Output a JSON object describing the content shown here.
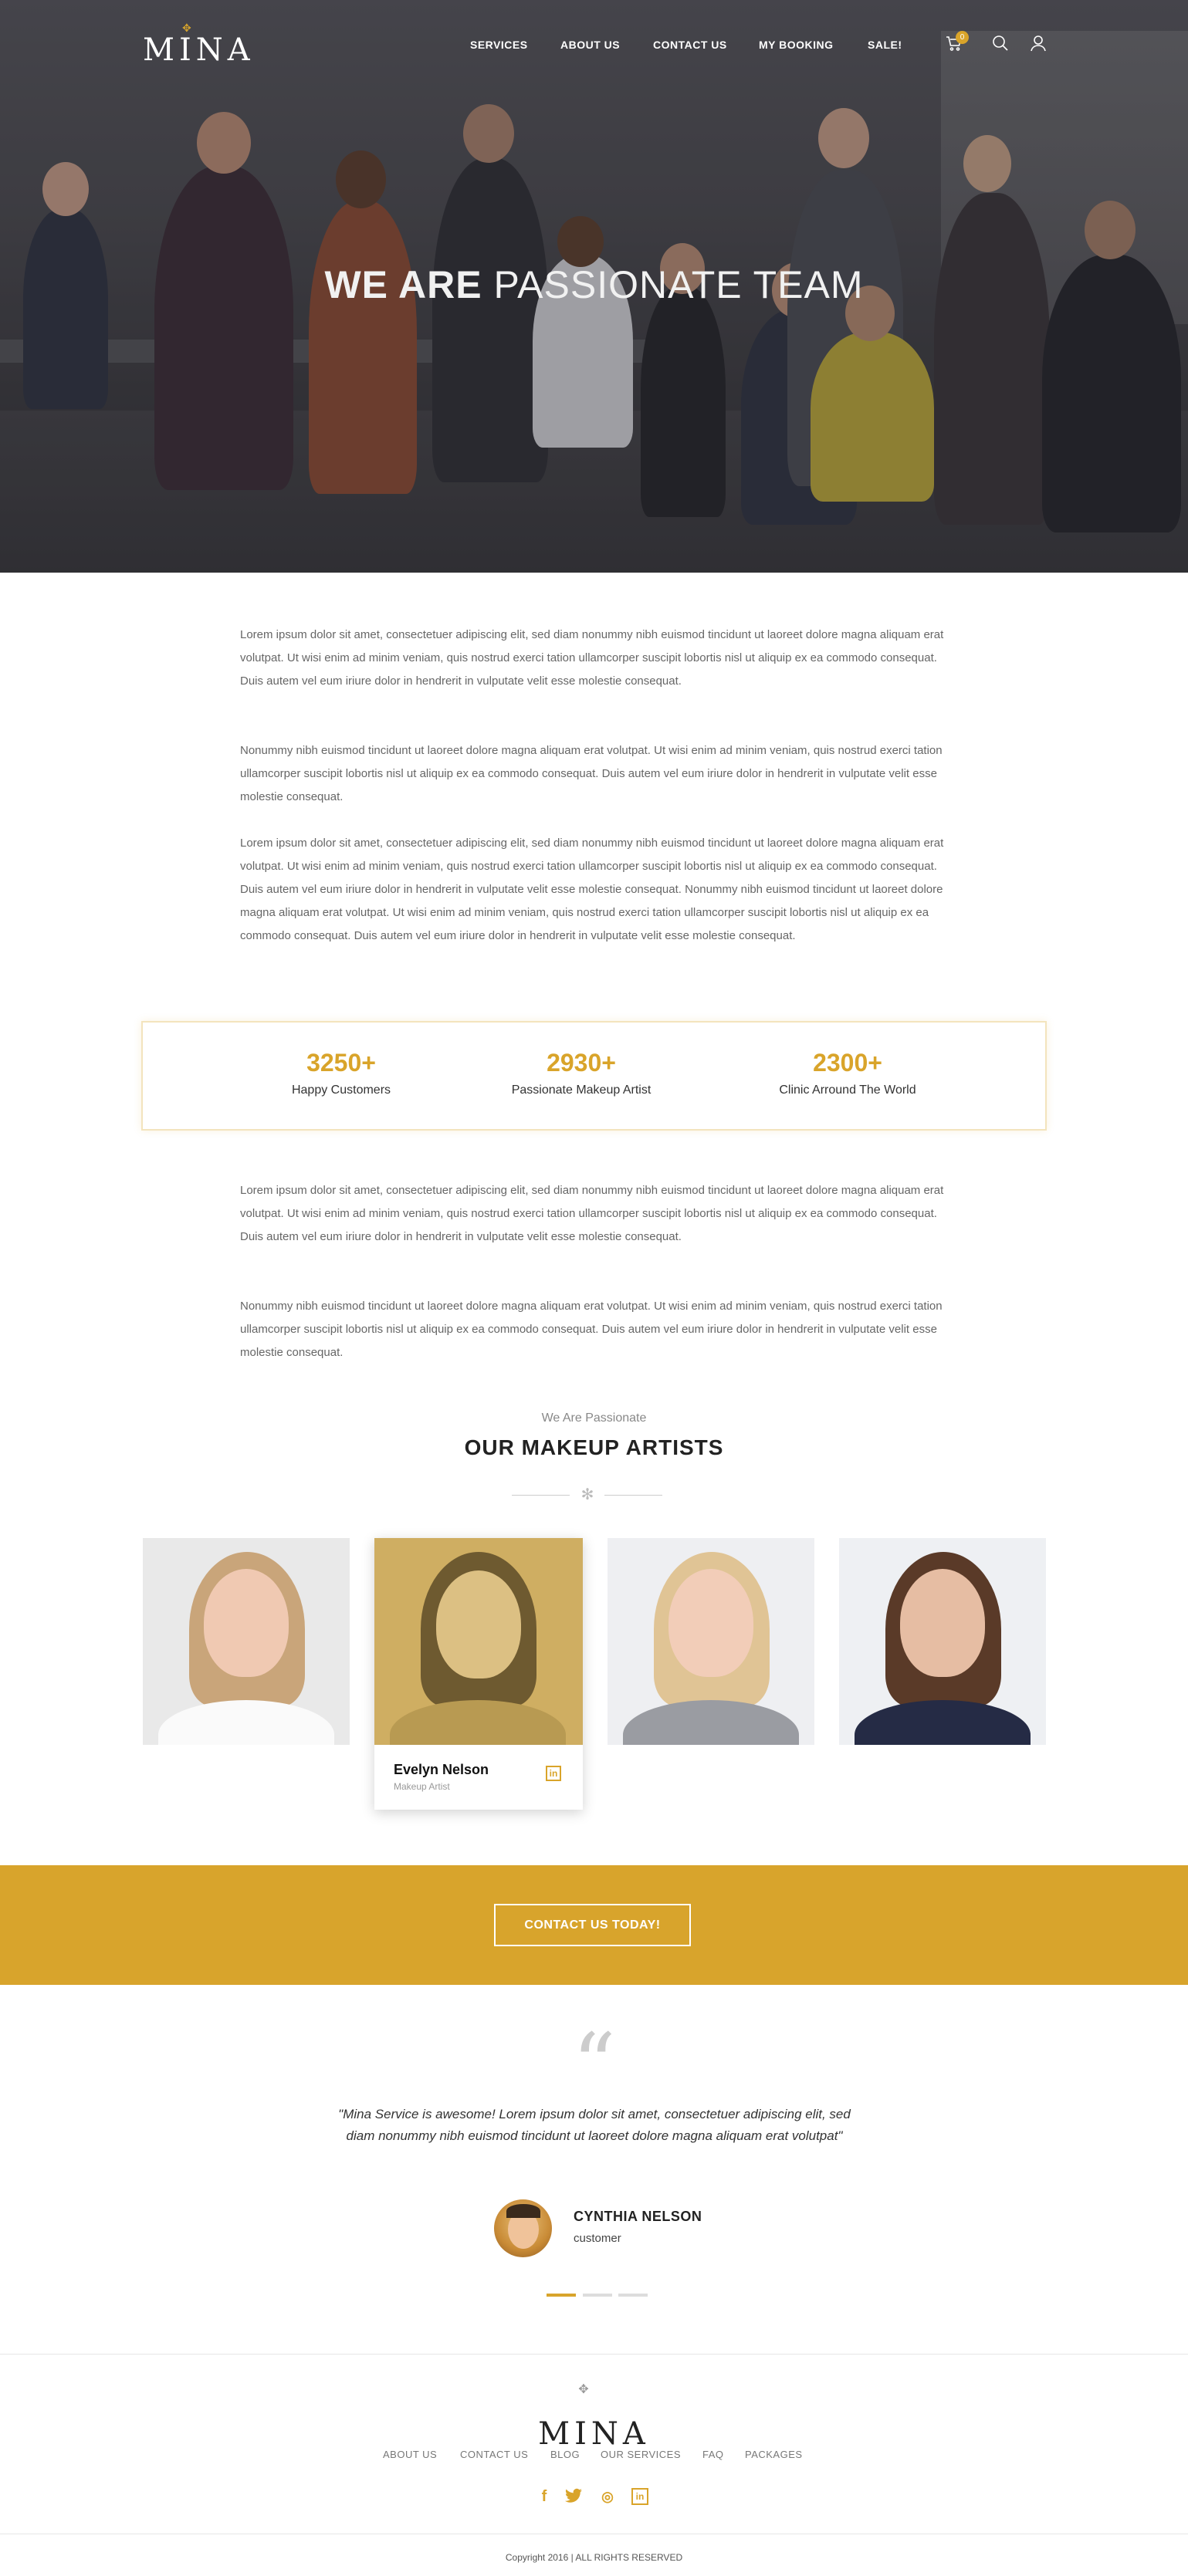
{
  "header": {
    "logo": "MINA",
    "nav": [
      "SERVICES",
      "ABOUT US",
      "CONTACT US",
      "MY BOOKING",
      "SALE!"
    ],
    "cart_count": "0",
    "icons": [
      "cart-icon",
      "search-icon",
      "user-icon"
    ]
  },
  "hero": {
    "title_bold": "WE ARE",
    "title_light": "PASSIONATE TEAM"
  },
  "intro_paragraphs": [
    "Lorem ipsum dolor sit amet, consectetuer adipiscing elit, sed diam nonummy nibh euismod tincidunt ut laoreet dolore magna aliquam erat volutpat. Ut wisi enim ad minim veniam, quis nostrud exerci tation ullamcorper suscipit lobortis nisl ut aliquip ex ea commodo consequat. Duis autem vel eum iriure dolor in hendrerit in vulputate velit esse molestie consequat.",
    "Nonummy nibh euismod tincidunt ut laoreet dolore magna aliquam erat volutpat. Ut wisi enim ad minim veniam, quis nostrud exerci tation ullamcorper suscipit lobortis nisl ut aliquip ex ea commodo consequat. Duis autem vel eum iriure dolor in hendrerit in vulputate velit esse molestie consequat.",
    "Lorem ipsum dolor sit amet, consectetuer adipiscing elit, sed diam nonummy nibh euismod tincidunt ut laoreet dolore magna aliquam erat volutpat. Ut wisi enim ad minim veniam, quis nostrud exerci tation ullamcorper suscipit lobortis nisl ut aliquip ex ea commodo consequat. Duis autem vel eum iriure dolor in hendrerit in vulputate velit esse molestie consequat. Nonummy nibh euismod tincidunt ut laoreet dolore magna aliquam erat volutpat. Ut wisi enim ad minim veniam, quis nostrud exerci tation ullamcorper suscipit lobortis nisl ut aliquip ex ea commodo consequat. Duis autem vel eum iriure dolor in hendrerit in vulputate velit esse molestie consequat."
  ],
  "stats": [
    {
      "value": "3250+",
      "label": "Happy Customers"
    },
    {
      "value": "2930+",
      "label": "Passionate Makeup Artist"
    },
    {
      "value": "2300+",
      "label": "Clinic Arround The World"
    }
  ],
  "more_paragraphs": [
    "Lorem ipsum dolor sit amet, consectetuer adipiscing elit, sed diam nonummy nibh euismod tincidunt ut laoreet dolore magna aliquam erat volutpat. Ut wisi enim ad minim veniam, quis nostrud exerci tation ullamcorper suscipit lobortis nisl ut aliquip ex ea commodo consequat. Duis autem vel eum iriure dolor in hendrerit in vulputate velit esse molestie consequat.",
    "Nonummy nibh euismod tincidunt ut laoreet dolore magna aliquam erat volutpat. Ut wisi enim ad minim veniam, quis nostrud exerci tation ullamcorper suscipit lobortis nisl ut aliquip ex ea commodo consequat. Duis autem vel eum iriure dolor in hendrerit in vulputate velit esse molestie consequat."
  ],
  "team": {
    "subtitle": "We Are Passionate",
    "title_bold": "OUR MAKEUP",
    "title_light": "ARTISTS",
    "featured": {
      "name": "Evelyn Nelson",
      "role": "Makeup Artist",
      "social": "in"
    }
  },
  "cta": {
    "button": "CONTACT US TODAY!"
  },
  "testimonial": {
    "mark": "“",
    "quote": "\"Mina Service is awesome! Lorem ipsum dolor sit amet, consectetuer adipiscing elit, sed diam nonummy nibh euismod tincidunt ut laoreet dolore magna aliquam erat volutpat\"",
    "name": "CYNTHIA NELSON",
    "role": "customer"
  },
  "footer": {
    "logo": "MINA",
    "links": [
      "ABOUT US",
      "CONTACT US",
      "BLOG",
      "OUR SERVICES",
      "FAQ",
      "PACKAGES"
    ],
    "social": [
      "f",
      "t",
      "◎",
      "in"
    ],
    "copyright": "Copyright 2016 | ALL RIGHTS RESERVED"
  },
  "colors": {
    "accent": "#d8a42c",
    "text": "#666666",
    "heading": "#222222"
  }
}
